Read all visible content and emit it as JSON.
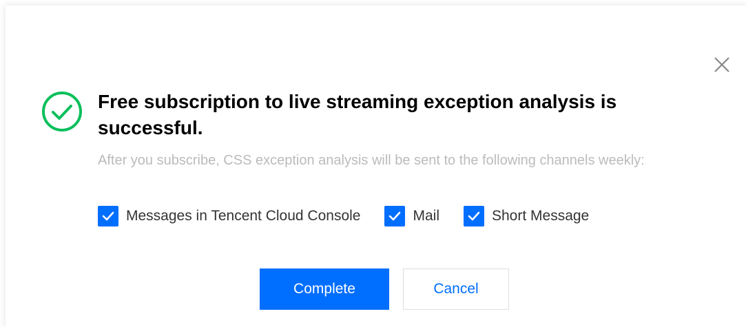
{
  "dialog": {
    "title": "Free subscription to live streaming exception analysis is successful.",
    "description": "After you subscribe, CSS exception analysis will be sent to the following channels weekly:",
    "status_icon": "check-circle-icon",
    "close_icon": "close-icon",
    "channels": [
      {
        "label": "Messages in Tencent Cloud Console",
        "checked": true
      },
      {
        "label": "Mail",
        "checked": true
      },
      {
        "label": "Short Message",
        "checked": true
      }
    ],
    "buttons": {
      "confirm_label": "Complete",
      "cancel_label": "Cancel"
    },
    "colors": {
      "accent": "#006eff",
      "success": "#0abf5b",
      "muted_text": "#bbbbbb"
    }
  }
}
